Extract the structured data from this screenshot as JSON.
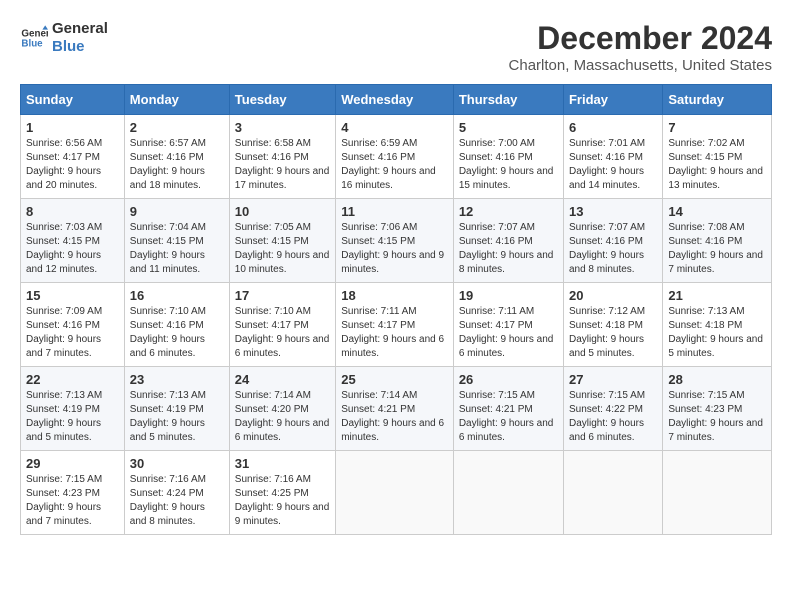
{
  "logo": {
    "line1": "General",
    "line2": "Blue"
  },
  "title": "December 2024",
  "location": "Charlton, Massachusetts, United States",
  "days_of_week": [
    "Sunday",
    "Monday",
    "Tuesday",
    "Wednesday",
    "Thursday",
    "Friday",
    "Saturday"
  ],
  "weeks": [
    [
      {
        "day": "1",
        "sunrise": "6:56 AM",
        "sunset": "4:17 PM",
        "daylight": "9 hours and 20 minutes."
      },
      {
        "day": "2",
        "sunrise": "6:57 AM",
        "sunset": "4:16 PM",
        "daylight": "9 hours and 18 minutes."
      },
      {
        "day": "3",
        "sunrise": "6:58 AM",
        "sunset": "4:16 PM",
        "daylight": "9 hours and 17 minutes."
      },
      {
        "day": "4",
        "sunrise": "6:59 AM",
        "sunset": "4:16 PM",
        "daylight": "9 hours and 16 minutes."
      },
      {
        "day": "5",
        "sunrise": "7:00 AM",
        "sunset": "4:16 PM",
        "daylight": "9 hours and 15 minutes."
      },
      {
        "day": "6",
        "sunrise": "7:01 AM",
        "sunset": "4:16 PM",
        "daylight": "9 hours and 14 minutes."
      },
      {
        "day": "7",
        "sunrise": "7:02 AM",
        "sunset": "4:15 PM",
        "daylight": "9 hours and 13 minutes."
      }
    ],
    [
      {
        "day": "8",
        "sunrise": "7:03 AM",
        "sunset": "4:15 PM",
        "daylight": "9 hours and 12 minutes."
      },
      {
        "day": "9",
        "sunrise": "7:04 AM",
        "sunset": "4:15 PM",
        "daylight": "9 hours and 11 minutes."
      },
      {
        "day": "10",
        "sunrise": "7:05 AM",
        "sunset": "4:15 PM",
        "daylight": "9 hours and 10 minutes."
      },
      {
        "day": "11",
        "sunrise": "7:06 AM",
        "sunset": "4:15 PM",
        "daylight": "9 hours and 9 minutes."
      },
      {
        "day": "12",
        "sunrise": "7:07 AM",
        "sunset": "4:16 PM",
        "daylight": "9 hours and 8 minutes."
      },
      {
        "day": "13",
        "sunrise": "7:07 AM",
        "sunset": "4:16 PM",
        "daylight": "9 hours and 8 minutes."
      },
      {
        "day": "14",
        "sunrise": "7:08 AM",
        "sunset": "4:16 PM",
        "daylight": "9 hours and 7 minutes."
      }
    ],
    [
      {
        "day": "15",
        "sunrise": "7:09 AM",
        "sunset": "4:16 PM",
        "daylight": "9 hours and 7 minutes."
      },
      {
        "day": "16",
        "sunrise": "7:10 AM",
        "sunset": "4:16 PM",
        "daylight": "9 hours and 6 minutes."
      },
      {
        "day": "17",
        "sunrise": "7:10 AM",
        "sunset": "4:17 PM",
        "daylight": "9 hours and 6 minutes."
      },
      {
        "day": "18",
        "sunrise": "7:11 AM",
        "sunset": "4:17 PM",
        "daylight": "9 hours and 6 minutes."
      },
      {
        "day": "19",
        "sunrise": "7:11 AM",
        "sunset": "4:17 PM",
        "daylight": "9 hours and 6 minutes."
      },
      {
        "day": "20",
        "sunrise": "7:12 AM",
        "sunset": "4:18 PM",
        "daylight": "9 hours and 5 minutes."
      },
      {
        "day": "21",
        "sunrise": "7:13 AM",
        "sunset": "4:18 PM",
        "daylight": "9 hours and 5 minutes."
      }
    ],
    [
      {
        "day": "22",
        "sunrise": "7:13 AM",
        "sunset": "4:19 PM",
        "daylight": "9 hours and 5 minutes."
      },
      {
        "day": "23",
        "sunrise": "7:13 AM",
        "sunset": "4:19 PM",
        "daylight": "9 hours and 5 minutes."
      },
      {
        "day": "24",
        "sunrise": "7:14 AM",
        "sunset": "4:20 PM",
        "daylight": "9 hours and 6 minutes."
      },
      {
        "day": "25",
        "sunrise": "7:14 AM",
        "sunset": "4:21 PM",
        "daylight": "9 hours and 6 minutes."
      },
      {
        "day": "26",
        "sunrise": "7:15 AM",
        "sunset": "4:21 PM",
        "daylight": "9 hours and 6 minutes."
      },
      {
        "day": "27",
        "sunrise": "7:15 AM",
        "sunset": "4:22 PM",
        "daylight": "9 hours and 6 minutes."
      },
      {
        "day": "28",
        "sunrise": "7:15 AM",
        "sunset": "4:23 PM",
        "daylight": "9 hours and 7 minutes."
      }
    ],
    [
      {
        "day": "29",
        "sunrise": "7:15 AM",
        "sunset": "4:23 PM",
        "daylight": "9 hours and 7 minutes."
      },
      {
        "day": "30",
        "sunrise": "7:16 AM",
        "sunset": "4:24 PM",
        "daylight": "9 hours and 8 minutes."
      },
      {
        "day": "31",
        "sunrise": "7:16 AM",
        "sunset": "4:25 PM",
        "daylight": "9 hours and 9 minutes."
      },
      null,
      null,
      null,
      null
    ]
  ],
  "labels": {
    "sunrise": "Sunrise:",
    "sunset": "Sunset:",
    "daylight": "Daylight:"
  }
}
